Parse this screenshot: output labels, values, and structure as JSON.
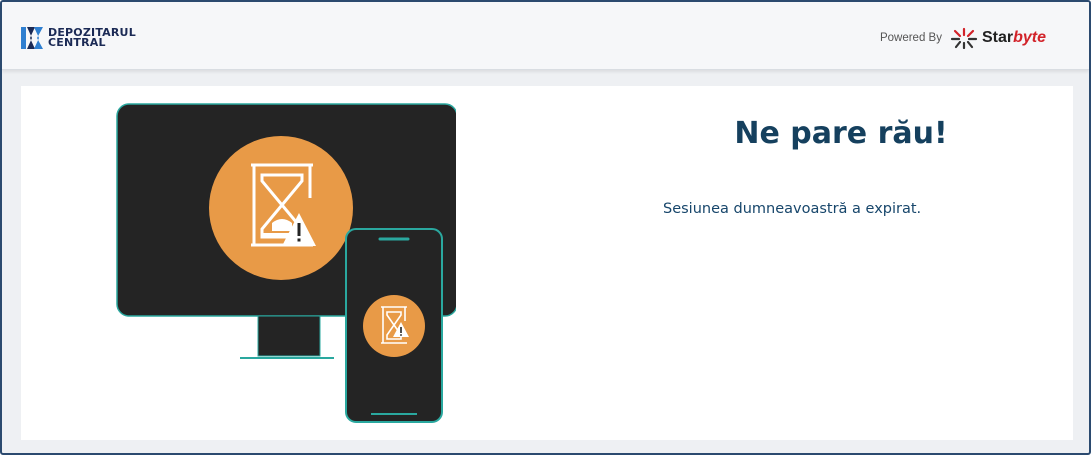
{
  "header": {
    "logo": {
      "line1": "DEPOZITARUL",
      "line2": "CENTRAL"
    },
    "powered_by": {
      "label": "Powered By",
      "brand_part1": "Star",
      "brand_part2": "byte"
    }
  },
  "main": {
    "title": "Ne pare rău!",
    "message": "Sesiunea dumneavoastră a expirat.",
    "illustration": {
      "icons": [
        "monitor-icon",
        "phone-icon",
        "hourglass-icon",
        "warning-icon"
      ]
    }
  },
  "colors": {
    "frame_border": "#2b4a6f",
    "header_bg": "#f6f7f9",
    "page_bg": "#eef0f3",
    "title": "#15405e",
    "device_dark": "#242424",
    "device_outline": "#2aa89f",
    "accent_orange": "#e89a47",
    "logo_navy": "#1b2a55",
    "logo_blue": "#2f7fd0",
    "starbyte_red": "#d2232a"
  }
}
